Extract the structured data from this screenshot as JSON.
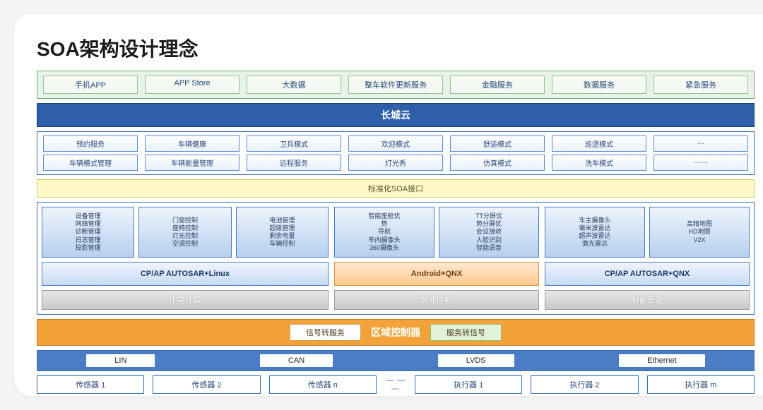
{
  "title": "SOA架构设计理念",
  "top_row": [
    "手机APP",
    "APP Store",
    "大数据",
    "整车软件更新服务",
    "金融服务",
    "数据服务",
    "紧急服务"
  ],
  "cloud_bar": "长城云",
  "service_rows": [
    [
      "预约服务",
      "车辆健康",
      "卫兵模式",
      "欢迎模式",
      "舒适模式",
      "巡逻模式",
      "…"
    ],
    [
      "车辆模式管理",
      "车辆能量管理",
      "远程服务",
      "灯光秀",
      "仿真模式",
      "洗车模式",
      "……"
    ]
  ],
  "soa_bar": "标准化SOA接口",
  "module_blocks": {
    "group1": [
      "设备管理\n网络管理\n诊断管理\n日志管理\n投影管理",
      "门窗控制\n座椅控制\n灯光控制\n空调控制",
      "电池管理\n超级管理\n剩余电量\n车辆控制"
    ],
    "group2": [
      "智能座舱优\n势\n导航\n车内摄像头\n360摄像头",
      "TT分屏优\n势分屏优\n会议接收\n人脸识别\n智能语音"
    ],
    "group3": [
      "车主摄像头\n毫米波雷达\n超声波雷达\n激光雷达",
      "高精地图\n HD地图\nV2X"
    ]
  },
  "os_labels": {
    "left": "CP/AP AUTOSAR+Linux",
    "mid": "Android+QNX",
    "right": "CP/AP AUTOSAR+QNX"
  },
  "hw_labels": {
    "left": "中央计算",
    "mid": "智能座舱",
    "right": "智能驾驶"
  },
  "zone": {
    "chip_left": "信号转服务",
    "center": "区域控制器",
    "chip_right": "服务转信号"
  },
  "buses": [
    "LIN",
    "CAN",
    "LVDS",
    "Ethernet"
  ],
  "devices_left": [
    "传感器 1",
    "传感器 2",
    "传感器 n"
  ],
  "devices_right": [
    "执行器 1",
    "执行器 2",
    "执行器 m"
  ],
  "dots": "— — —"
}
